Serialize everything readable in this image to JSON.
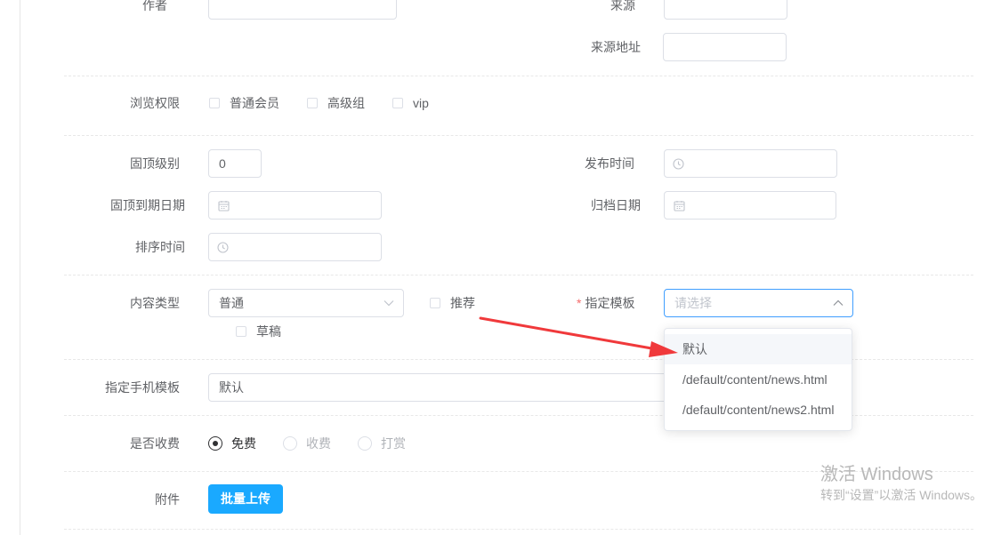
{
  "form": {
    "author_label": "作者",
    "source_label": "来源",
    "source_url_label": "来源地址",
    "browse_permission_label": "浏览权限",
    "permissions": [
      "普通会员",
      "高级组",
      "vip"
    ],
    "pin_level_label": "固顶级别",
    "pin_level_value": "0",
    "publish_time_label": "发布时间",
    "pin_expire_label": "固顶到期日期",
    "archive_date_label": "归档日期",
    "sort_time_label": "排序时间",
    "content_type_label": "内容类型",
    "content_type_value": "普通",
    "recommend_label": "推荐",
    "draft_label": "草稿",
    "template_required_mark": "*",
    "template_label": "指定模板",
    "template_placeholder": "请选择",
    "template_options": [
      "默认",
      "/default/content/news.html",
      "/default/content/news2.html"
    ],
    "mobile_template_label": "指定手机模板",
    "mobile_template_value": "默认",
    "charge_label": "是否收费",
    "charge_options": [
      "免费",
      "收费",
      "打赏"
    ],
    "charge_selected": "免费",
    "attachment_label": "附件",
    "upload_button": "批量上传"
  },
  "watermark": {
    "title": "激活 Windows",
    "subtitle": "转到“设置”以激活 Windows。"
  },
  "colors": {
    "primary": "#409eff",
    "upload_button": "#1aa9ff",
    "arrow": "#f0393b",
    "required": "#f56c6c"
  }
}
